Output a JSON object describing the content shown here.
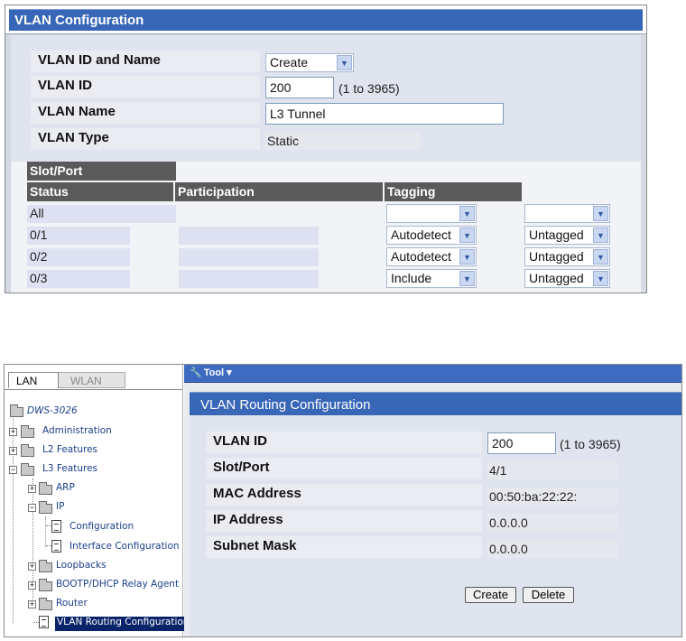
{
  "vlan_config": {
    "title": "VLAN Configuration",
    "rows": [
      {
        "label": "VLAN ID and Name",
        "select_value": "Create"
      },
      {
        "label": "VLAN ID",
        "input_value": "200",
        "hint": "(1 to 3965)"
      },
      {
        "label": "VLAN Name",
        "input_value": "L3 Tunnel"
      },
      {
        "label": "VLAN Type",
        "value": "Static"
      }
    ],
    "table": {
      "header_slot_port": "Slot/Port",
      "col_status": "Status",
      "col_participation": "Participation",
      "col_tagging": "Tagging",
      "rows": [
        {
          "port": "All",
          "participation": "",
          "tagging": ""
        },
        {
          "port": "0/1",
          "participation": "Autodetect",
          "tagging": "Untagged"
        },
        {
          "port": "0/2",
          "participation": "Autodetect",
          "tagging": "Untagged"
        },
        {
          "port": "0/3",
          "participation": "Include",
          "tagging": "Untagged"
        }
      ]
    }
  },
  "nav": {
    "tabs": [
      "LAN",
      "WLAN"
    ],
    "root": "DWS-3026",
    "items": [
      {
        "label": "Administration"
      },
      {
        "label": "L2 Features"
      },
      {
        "label": "L3 Features"
      },
      {
        "label": "ARP"
      },
      {
        "label": "IP"
      },
      {
        "label": "Configuration"
      },
      {
        "label": "Interface Configuration"
      },
      {
        "label": "Loopbacks"
      },
      {
        "label": "BOOTP/DHCP Relay Agent"
      },
      {
        "label": "Router"
      },
      {
        "label": "VLAN Routing Configuration"
      }
    ]
  },
  "toolbar": {
    "tool_label": "Tool"
  },
  "vlan_routing": {
    "title": "VLAN Routing Configuration",
    "rows": [
      {
        "label": "VLAN ID",
        "input_value": "200",
        "hint": "(1 to 3965)"
      },
      {
        "label": "Slot/Port",
        "value": "4/1"
      },
      {
        "label": "MAC Address",
        "value": "00:50:ba:22:22:"
      },
      {
        "label": "IP Address",
        "value": "0.0.0.0"
      },
      {
        "label": "Subnet Mask",
        "value": "0.0.0.0"
      }
    ],
    "create_label": "Create",
    "delete_label": "Delete"
  }
}
